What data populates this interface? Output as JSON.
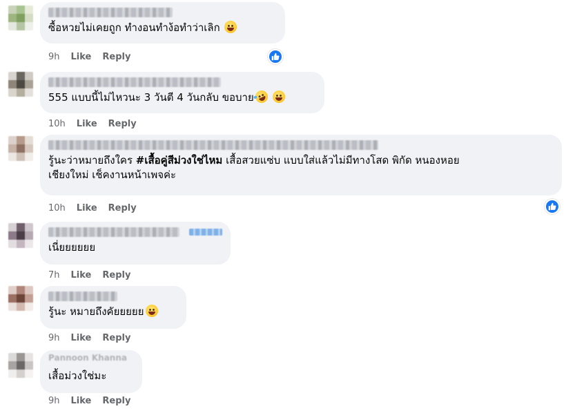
{
  "comments": [
    {
      "text": "ซื้อหวยไม่เคยถูก ทำงอนทำง้อทำว่าเลิก",
      "emoji": [
        "smiling-face-icon"
      ],
      "time": "9h",
      "like": "Like",
      "reply": "Reply",
      "has_reaction": true
    },
    {
      "text": "555 แบบนี้ไม่ไหวนะ 3 วันตี 4 วันกลับ ขอบาย",
      "emoji": [
        "rofl-face-icon",
        "grinning-face-icon"
      ],
      "time": "10h",
      "like": "Like",
      "reply": "Reply",
      "has_reaction": false
    },
    {
      "line1_pre": "รู้นะว่าหมายถึงใคร ",
      "line1_tag": "#เสื้อคู่สีม่วงใช่ไหม",
      "line1_post": " เสื้อสวยแซ่บ แบบใส่แล้วไม่มีทางโสด พิกัด หนองหอย",
      "line2": "เชียงใหม่ เช็คงานหน้าเพจค่ะ",
      "time": "10h",
      "like": "Like",
      "reply": "Reply",
      "has_reaction": true
    },
    {
      "text": "เนี่ยยยยยย",
      "time": "7h",
      "like": "Like",
      "reply": "Reply",
      "has_reaction": false
    },
    {
      "text": "รู้นะ หมายถึงคัยยยยย",
      "emoji": [
        "grinning-face-icon"
      ],
      "time": "9h",
      "like": "Like",
      "reply": "Reply",
      "has_reaction": false
    },
    {
      "author_partial": "Pannoon Khanna",
      "text": "เสื้อม่วงใช่มะ",
      "time": "9h",
      "like": "Like",
      "reply": "Reply",
      "has_reaction": false
    }
  ],
  "colors": {
    "bubble": "#f0f2f5",
    "meta_text": "#65676b",
    "like_blue": "#1877f2"
  }
}
